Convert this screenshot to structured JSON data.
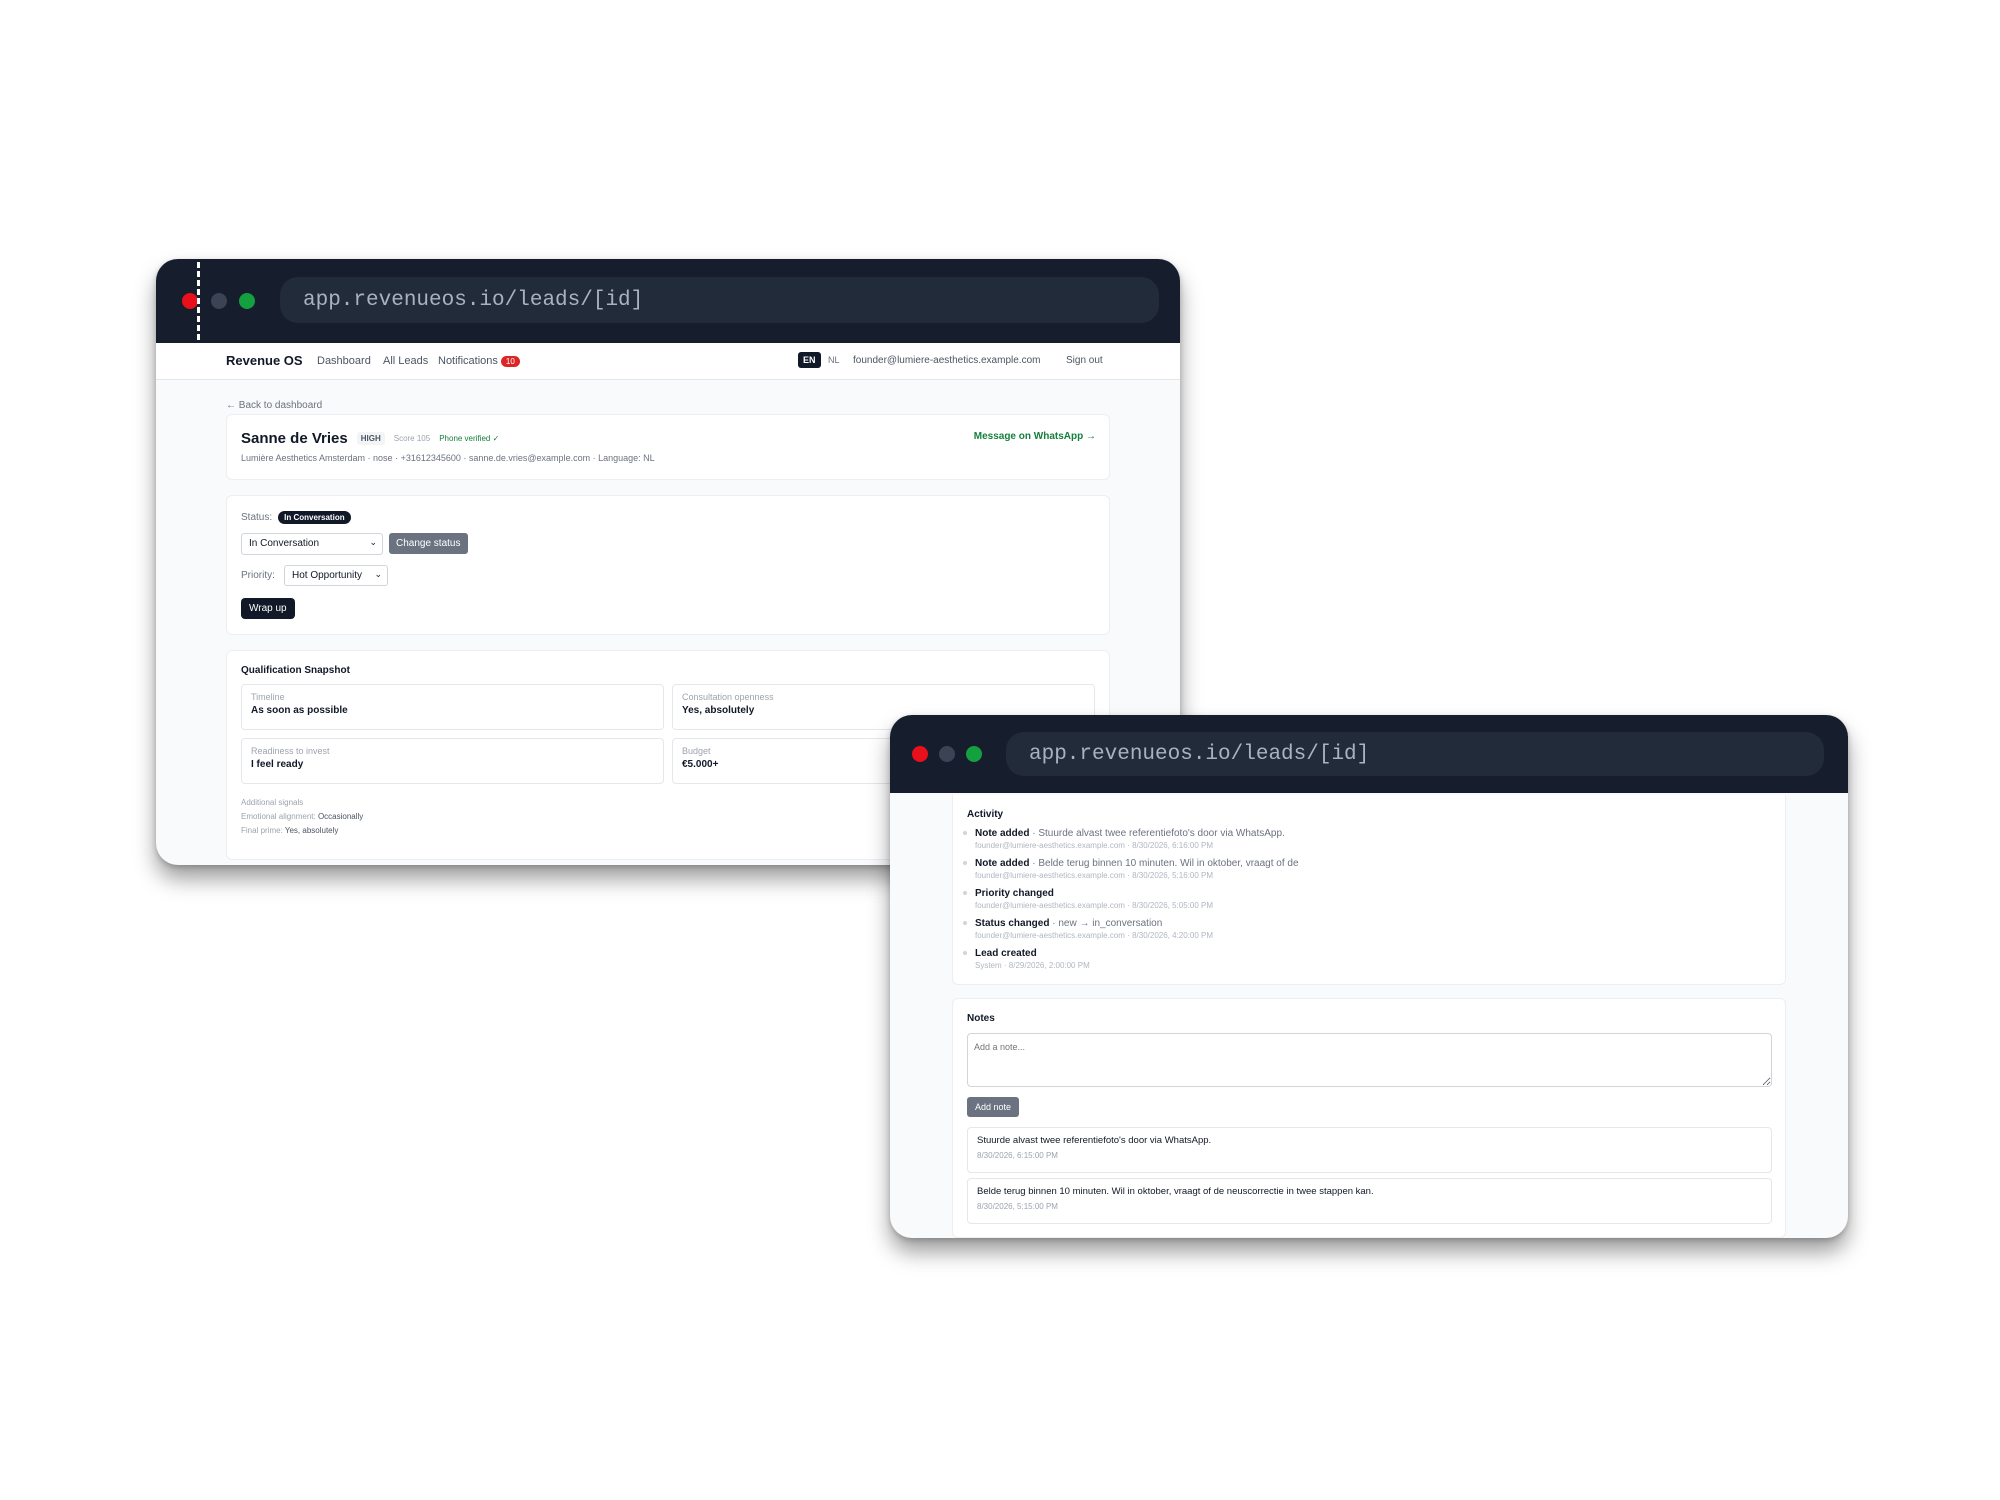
{
  "url": "app.revenueos.io/leads/[id]",
  "nav": {
    "brand": "Revenue OS",
    "links": [
      "Dashboard",
      "All Leads",
      "Notifications"
    ],
    "notification_count": "10",
    "lang_active": "EN",
    "lang_other": "NL",
    "user_email": "founder@lumiere-aesthetics.example.com",
    "sign_out": "Sign out"
  },
  "back_link": "← Back to dashboard",
  "lead": {
    "name": "Sanne de Vries",
    "priority_badge": "HIGH",
    "score": "Score 105",
    "phone_verified": "Phone verified ✓",
    "details": "Lumière Aesthetics Amsterdam · nose · +31612345600 · sanne.de.vries@example.com · Language: NL",
    "whatsapp": "Message on WhatsApp →"
  },
  "status_card": {
    "status_label": "Status:",
    "status_value": "In Conversation",
    "status_select": "In Conversation",
    "change_button": "Change status",
    "priority_label": "Priority:",
    "priority_select": "Hot Opportunity",
    "wrap_button": "Wrap up"
  },
  "snapshot": {
    "title": "Qualification Snapshot",
    "fields": [
      {
        "label": "Timeline",
        "value": "As soon as possible"
      },
      {
        "label": "Consultation openness",
        "value": "Yes, absolutely"
      },
      {
        "label": "Readiness to invest",
        "value": "I feel ready"
      },
      {
        "label": "Budget",
        "value": "€5.000+"
      }
    ],
    "additional_title": "Additional signals",
    "signals": [
      {
        "label": "Emotional alignment:",
        "value": "Occasionally"
      },
      {
        "label": "Final prime:",
        "value": "Yes, absolutely"
      }
    ]
  },
  "activity": {
    "title": "Activity",
    "items": [
      {
        "title": "Note added",
        "detail": "· Stuurde alvast twee referentiefoto's door via WhatsApp.",
        "meta": "founder@lumiere-aesthetics.example.com · 8/30/2026, 6:16:00 PM"
      },
      {
        "title": "Note added",
        "detail": "· Belde terug binnen 10 minuten. Wil in oktober, vraagt of de",
        "meta": "founder@lumiere-aesthetics.example.com · 8/30/2026, 5:16:00 PM"
      },
      {
        "title": "Priority changed",
        "detail": "",
        "meta": "founder@lumiere-aesthetics.example.com · 8/30/2026, 5:05:00 PM"
      },
      {
        "title": "Status changed",
        "detail": "· new → in_conversation",
        "meta": "founder@lumiere-aesthetics.example.com · 8/30/2026, 4:20:00 PM"
      },
      {
        "title": "Lead created",
        "detail": "",
        "meta": "System · 8/29/2026, 2:00:00 PM"
      }
    ]
  },
  "notes": {
    "title": "Notes",
    "placeholder": "Add a note...",
    "add_button": "Add note",
    "items": [
      {
        "text": "Stuurde alvast twee referentiefoto's door via WhatsApp.",
        "time": "8/30/2026, 6:15:00 PM"
      },
      {
        "text": "Belde terug binnen 10 minuten. Wil in oktober, vraagt of de neuscorrectie in twee stappen kan.",
        "time": "8/30/2026, 5:15:00 PM"
      }
    ]
  },
  "colors": {
    "titlebar": "#161e2e",
    "urlbar": "#222b3a",
    "close": "#e8101b",
    "minimize": "#3b4454",
    "maximize": "#14a03f",
    "accent_green": "#15803d",
    "badge_red": "#dc2626"
  }
}
